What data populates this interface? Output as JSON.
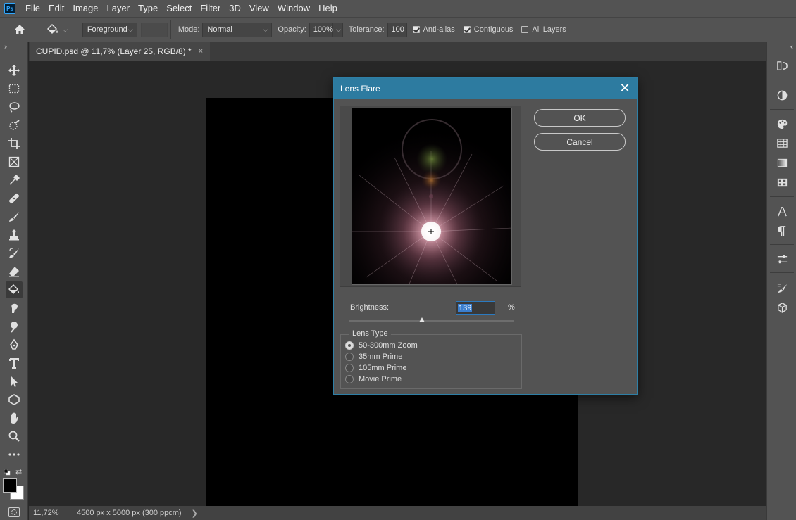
{
  "menubar": {
    "logo": "Ps",
    "items": [
      "File",
      "Edit",
      "Image",
      "Layer",
      "Type",
      "Select",
      "Filter",
      "3D",
      "View",
      "Window",
      "Help"
    ]
  },
  "options": {
    "fill_source": "Foreground",
    "mode_label": "Mode:",
    "mode_value": "Normal",
    "opacity_label": "Opacity:",
    "opacity_value": "100%",
    "tolerance_label": "Tolerance:",
    "tolerance_value": "100",
    "antialias_label": "Anti-alias",
    "antialias_checked": true,
    "contiguous_label": "Contiguous",
    "contiguous_checked": true,
    "alllayers_label": "All Layers",
    "alllayers_checked": false
  },
  "document": {
    "tab_title": "CUPID.psd @ 11,7% (Layer 25, RGB/8) *",
    "close_glyph": "×"
  },
  "status": {
    "zoom": "11,72%",
    "doc_size": "4500 px x 5000 px (300 ppcm)",
    "arrow": "❯"
  },
  "dialog": {
    "title": "Lens Flare",
    "ok_label": "OK",
    "cancel_label": "Cancel",
    "brightness_label": "Brightness:",
    "brightness_value": "139",
    "brightness_unit": "%",
    "lens_type_label": "Lens Type",
    "lens_types": [
      "50-300mm Zoom",
      "35mm Prime",
      "105mm Prime",
      "Movie Prime"
    ],
    "selected_lens_index": 0
  },
  "colors": {
    "accent": "#2d7ba0",
    "foreground_swatch": "#000000",
    "background_swatch": "#ffffff"
  },
  "toolbar_icons": [
    "move-icon",
    "marquee-icon",
    "lasso-icon",
    "quick-select-icon",
    "crop-icon",
    "frame-icon",
    "eyedropper-icon",
    "healing-icon",
    "brush-icon",
    "stamp-icon",
    "history-brush-icon",
    "eraser-icon",
    "paint-bucket-icon",
    "smudge-icon",
    "dodge-icon",
    "pen-icon",
    "type-icon",
    "path-select-icon",
    "shape-icon",
    "hand-icon",
    "zoom-icon",
    "more-icon"
  ]
}
